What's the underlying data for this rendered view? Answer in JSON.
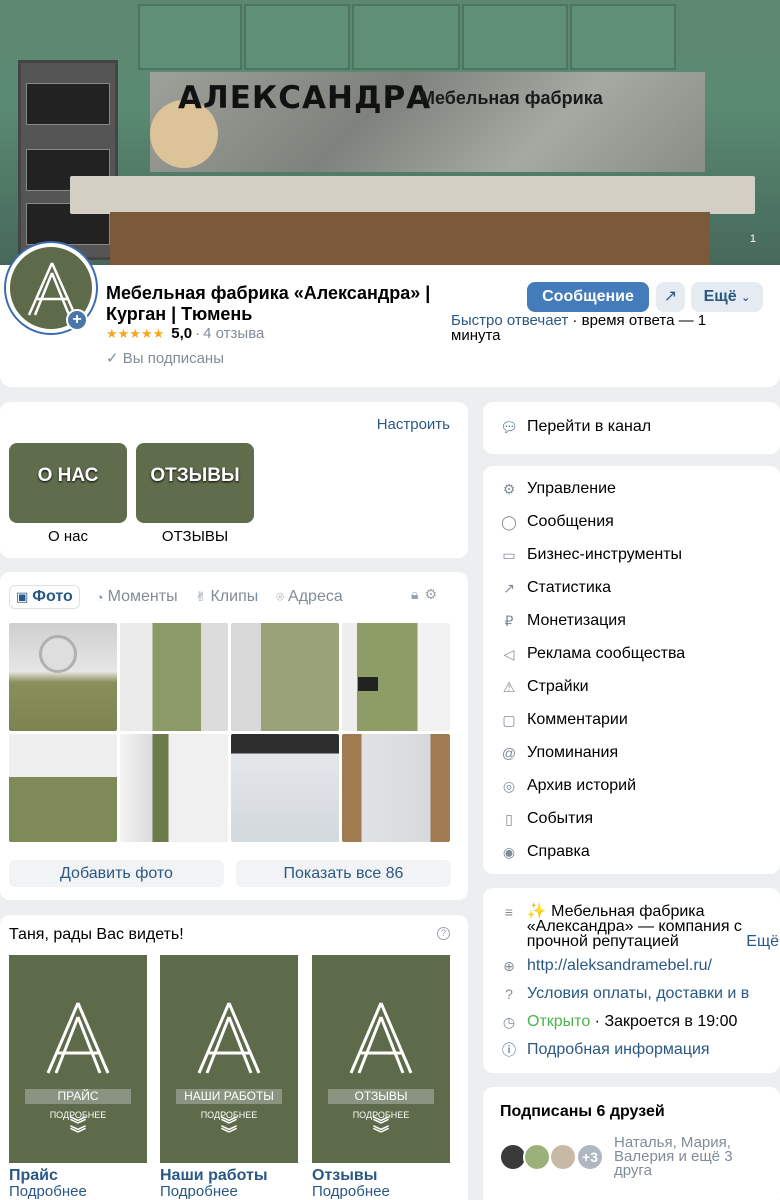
{
  "cover": {
    "brand": "АЛЕКСАНДРА",
    "subtitle": "Мебельная фабрика",
    "counter": "1"
  },
  "header": {
    "name": "Мебельная фабрика «Александра» | Курган | Тюмень",
    "rating_value": "5,0",
    "rating_stars": 5,
    "reviews": "4 отзыва",
    "subscribed": "Вы подписаны",
    "message_button": "Сообщение",
    "more_button": "Ещё",
    "reply_fast": "Быстро отвечает",
    "reply_time": "время ответа — 1 минута"
  },
  "apps": {
    "setup_link": "Настроить",
    "items": [
      {
        "tile_text": "О НАС",
        "label": "О нас"
      },
      {
        "tile_text": "ОТЗЫВЫ",
        "label": "ОТЗЫВЫ"
      }
    ]
  },
  "media": {
    "tabs": [
      "Фото",
      "Моменты",
      "Клипы",
      "Адреса"
    ],
    "photos": [
      {
        "kind": "bathroom-vanity"
      },
      {
        "kind": "hallway-wardrobe"
      },
      {
        "kind": "wardrobe-green"
      },
      {
        "kind": "kitchen-column"
      },
      {
        "kind": "kitchen-corner"
      },
      {
        "kind": "living-room"
      },
      {
        "kind": "white-island"
      },
      {
        "kind": "white-cabinet"
      }
    ],
    "add_photo": "Добавить фото",
    "show_all": "Показать все 86"
  },
  "welcome": {
    "title": "Таня, рады Вас видеть!",
    "widgets": [
      {
        "stripe": "ПРАЙС",
        "more": "ПОДРОБНЕЕ",
        "name": "Прайс",
        "sub": "Подробнее"
      },
      {
        "stripe": "НАШИ РАБОТЫ",
        "more": "ПОДРОБНЕЕ",
        "name": "Наши работы",
        "sub": "Подробнее"
      },
      {
        "stripe": "ОТЗЫВЫ",
        "more": "ПОДРОБНЕЕ",
        "name": "Отзывы",
        "sub": "Подробнее"
      }
    ]
  },
  "channel": {
    "label": "Перейти в канал"
  },
  "menu": {
    "items": [
      {
        "label": "Управление",
        "icon": "gear-icon"
      },
      {
        "label": "Сообщения",
        "icon": "chat-icon"
      },
      {
        "label": "Бизнес-инструменты",
        "icon": "briefcase-icon"
      },
      {
        "label": "Статистика",
        "icon": "stats-icon"
      },
      {
        "label": "Монетизация",
        "icon": "ruble-icon"
      },
      {
        "label": "Реклама сообщества",
        "icon": "megaphone-icon"
      },
      {
        "label": "Страйки",
        "icon": "warning-icon"
      },
      {
        "label": "Комментарии",
        "icon": "comment-icon"
      },
      {
        "label": "Упоминания",
        "icon": "at-icon"
      },
      {
        "label": "Архив историй",
        "icon": "archive-icon"
      },
      {
        "label": "События",
        "icon": "event-icon"
      },
      {
        "label": "Справка",
        "icon": "help-icon"
      }
    ]
  },
  "info": {
    "desc_line1": "✨ Мебельная фабрика",
    "desc_line2": "«Александра» — компания с",
    "desc_line3": "прочной репутацией",
    "desc_more": "Ещё",
    "website": "http://aleksandramebel.ru/",
    "terms": "Условия оплаты, доставки и в",
    "open_status": "Открыто",
    "closes": "Закроется в 19:00",
    "details": "Подробная информация"
  },
  "friends": {
    "title": "Подписаны 6 друзей",
    "extra_count": "+3",
    "names": "Наталья, Мария, Валерия и ещё 3 друга"
  },
  "colors": {
    "accent": "#447bba",
    "link": "#2a5885",
    "muted": "#818c99",
    "tile_green": "#5e6b4a",
    "open_green": "#4bb34b",
    "star": "#f5a623"
  }
}
